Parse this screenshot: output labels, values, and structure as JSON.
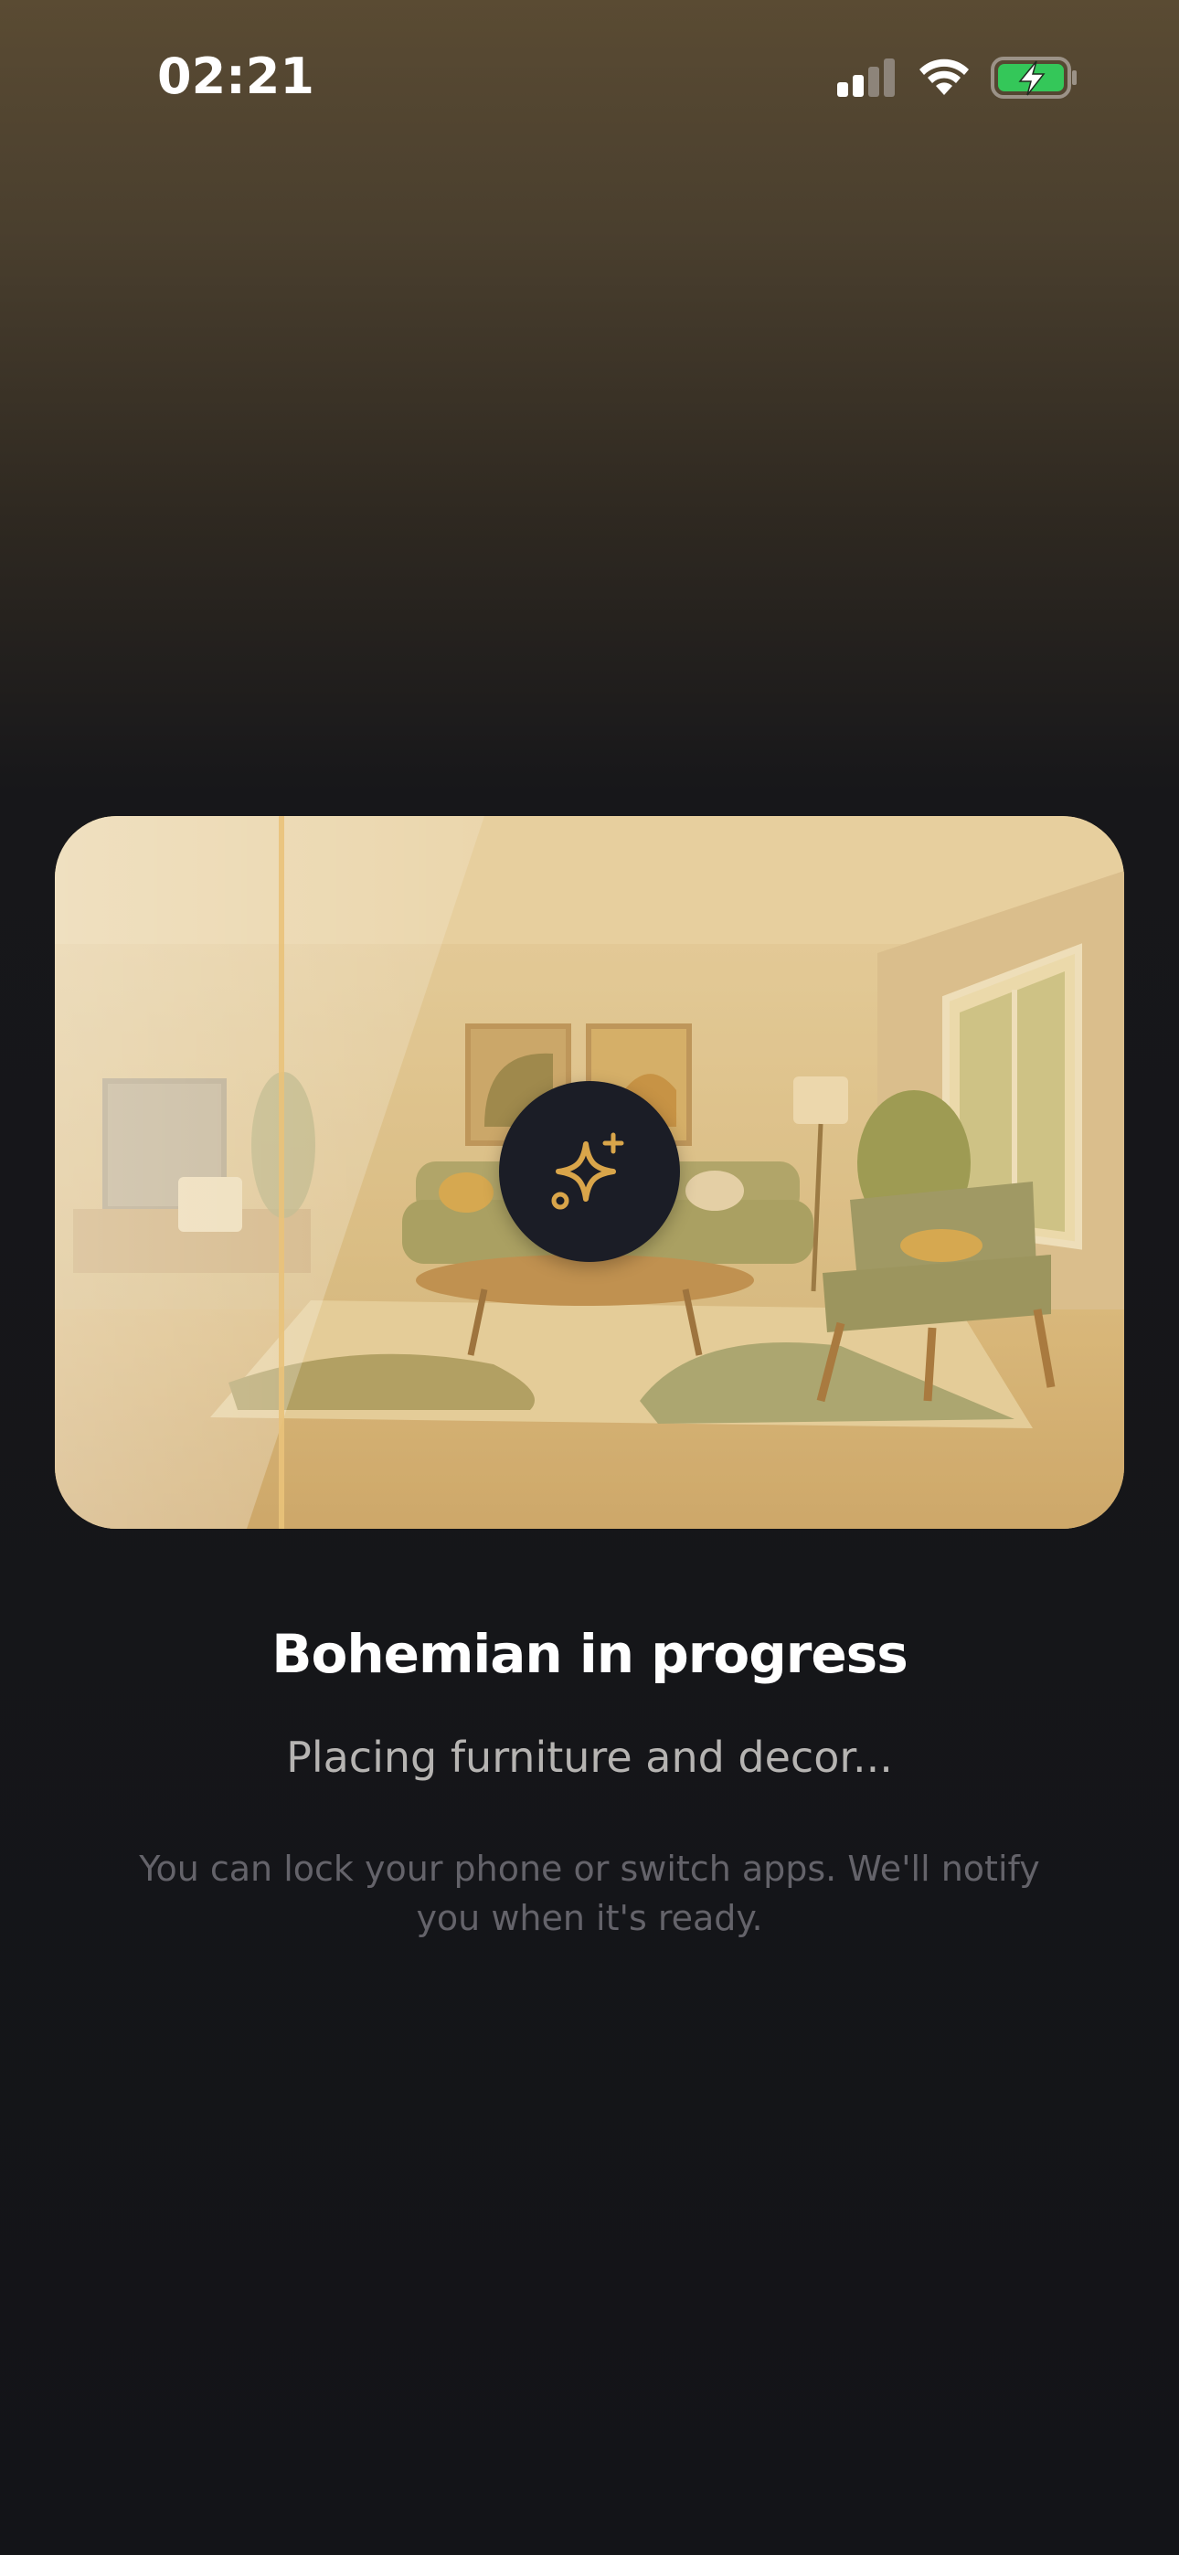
{
  "status_bar": {
    "time": "02:21",
    "signal_icon": "cellular-signal-icon",
    "wifi_icon": "wifi-icon",
    "battery_icon": "battery-charging-icon",
    "battery_color": "#34c759"
  },
  "preview": {
    "image_description_icon": "sparkle-icon",
    "accent": "#d9a54a"
  },
  "content": {
    "title": "Bohemian in progress",
    "subtitle": "Placing furniture and decor...",
    "note": "You can lock your phone or switch apps. We'll notify you when it's ready."
  }
}
